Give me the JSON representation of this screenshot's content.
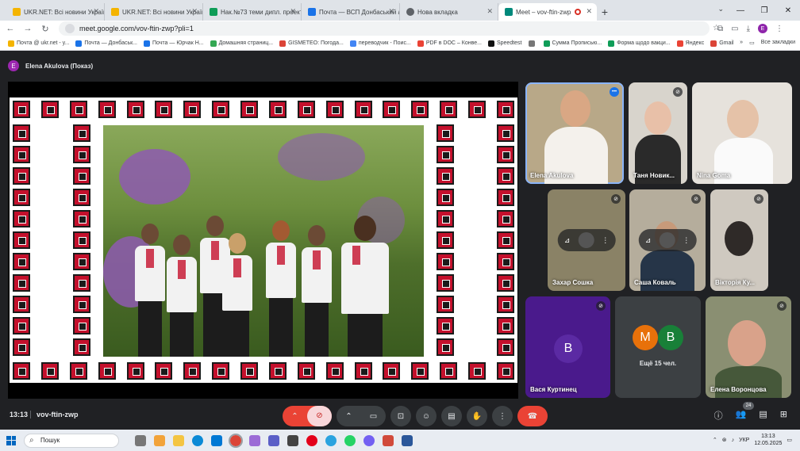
{
  "browser": {
    "tabs": [
      {
        "title": "UKR.NET: Всі новини Україні...",
        "color": "#f4b400"
      },
      {
        "title": "UKR.NET: Всі новини Україні...",
        "color": "#f4b400"
      },
      {
        "title": "Нак.№73 теми дипл. проектів...",
        "color": "#0f9d58"
      },
      {
        "title": "Почта — ВСП Донбаський агр...",
        "color": "#1a73e8"
      },
      {
        "title": "Нова вкладка",
        "color": "#5f6368"
      },
      {
        "title": "Meet – vov-ftin-zwp",
        "color": "#00897b"
      }
    ],
    "new_tab": "+",
    "window_controls": {
      "minimize": "—",
      "restore": "❐",
      "close": "✕"
    },
    "url": "meet.google.com/vov-ftin-zwp?pli=1",
    "profile_initial": "E",
    "bookmarks": [
      {
        "label": "Почта @ ukr.net - у...",
        "color": "#f4b400"
      },
      {
        "label": "Почта — Донбаськ...",
        "color": "#1a73e8"
      },
      {
        "label": "Почта — Юрчак Н...",
        "color": "#1a73e8"
      },
      {
        "label": "Домашняя страниц...",
        "color": "#34a853"
      },
      {
        "label": "GISMETEO: Погода...",
        "color": "#db4437"
      },
      {
        "label": "переводчик - Поис...",
        "color": "#4285f4"
      },
      {
        "label": "PDF в DOC – Конве...",
        "color": "#ea4335"
      },
      {
        "label": "Speedtest",
        "color": "#111111"
      },
      {
        "label": "",
        "color": "#777777"
      },
      {
        "label": "Сумма Прописью...",
        "color": "#0f9d58"
      },
      {
        "label": "Форма щодо вакци...",
        "color": "#0f9d58"
      },
      {
        "label": "Яндекс",
        "color": "#ea4335"
      },
      {
        "label": "Gmail",
        "color": "#db4437"
      }
    ],
    "bookmarks_more": "»",
    "all_bookmarks": "Все закладки"
  },
  "meet": {
    "presenter": {
      "initial": "E",
      "label": "Elena Akulova (Показ)"
    },
    "participants": [
      {
        "name": "Elena Akulova",
        "state": "speaking"
      },
      {
        "name": "Таня Новик...",
        "state": "muted"
      },
      {
        "name": "Nina Goma",
        "state": "none"
      },
      {
        "name": "Захар Сошка",
        "state": "muted"
      },
      {
        "name": "Саша Коваль",
        "state": "muted"
      },
      {
        "name": "Вікторія Ку...",
        "state": "muted"
      },
      {
        "name": "Вася Куртинец",
        "initial": "В",
        "state": "muted"
      },
      {
        "name": "Елена Воронцова",
        "state": "muted"
      }
    ],
    "more": {
      "initials": [
        "M",
        "B"
      ],
      "colors": [
        "#e8710a",
        "#188038"
      ],
      "label": "Ещё 15 чел."
    },
    "time": "13:13",
    "meeting_code": "vov-ftin-zwp",
    "participant_count": "24",
    "colors": {
      "accent": "#8ab4f8",
      "hangup": "#ea4335",
      "presenter": "#9c27b0",
      "vasya_tile": "#4a1a8c"
    }
  },
  "taskbar": {
    "search_placeholder": "Пошук",
    "lang": "УКР",
    "time": "13:13",
    "date": "12.05.2025"
  }
}
